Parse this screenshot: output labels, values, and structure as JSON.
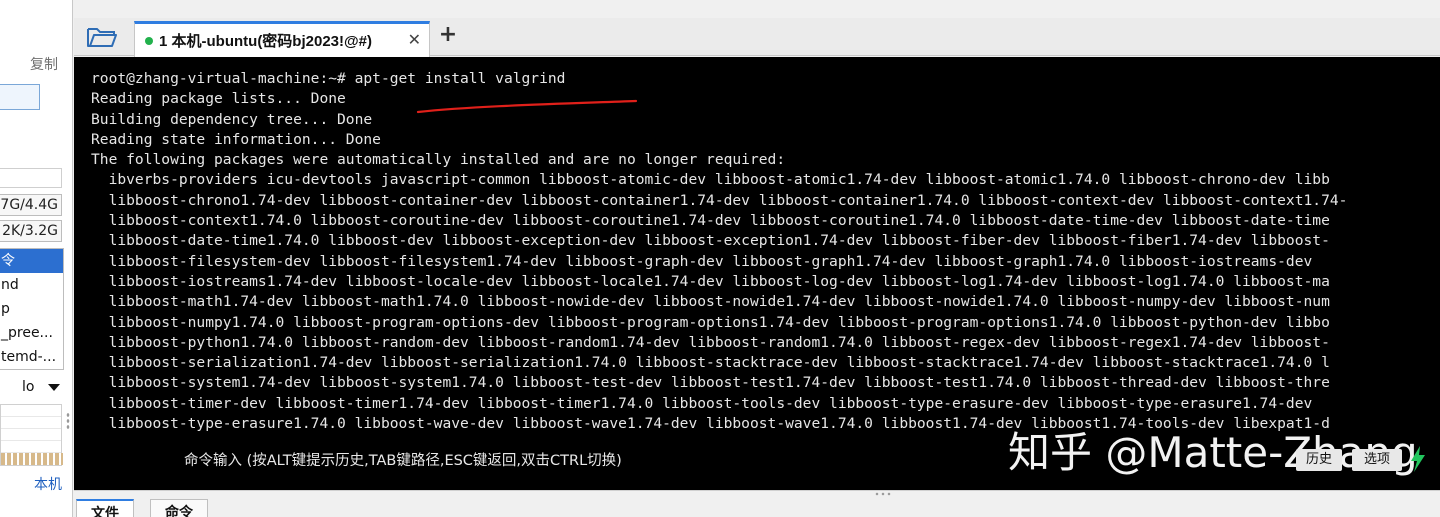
{
  "sidebar": {
    "copy_label": "复制",
    "stats": [
      "7G/4.4G",
      "2K/3.2G"
    ],
    "process_items": [
      "令",
      "nd",
      "p",
      "_pree...",
      "temd-..."
    ],
    "selected_index": 0,
    "dropdown_value": "lo",
    "local_label": "本机"
  },
  "tabbar": {
    "tab_title": "1 本机-ubuntu(密码bj2023!@#)",
    "tab_status_color": "#22b14c",
    "close_glyph": "✕",
    "add_glyph": "+"
  },
  "terminal": {
    "lines": [
      "root@zhang-virtual-machine:~# apt-get install valgrind",
      "Reading package lists... Done",
      "Building dependency tree... Done",
      "Reading state information... Done",
      "The following packages were automatically installed and are no longer required:",
      "  ibverbs-providers icu-devtools javascript-common libboost-atomic-dev libboost-atomic1.74-dev libboost-atomic1.74.0 libboost-chrono-dev libb",
      "  libboost-chrono1.74-dev libboost-container-dev libboost-container1.74-dev libboost-container1.74.0 libboost-context-dev libboost-context1.74-",
      "  libboost-context1.74.0 libboost-coroutine-dev libboost-coroutine1.74-dev libboost-coroutine1.74.0 libboost-date-time-dev libboost-date-time",
      "  libboost-date-time1.74.0 libboost-dev libboost-exception-dev libboost-exception1.74-dev libboost-fiber-dev libboost-fiber1.74-dev libboost-",
      "  libboost-filesystem-dev libboost-filesystem1.74-dev libboost-graph-dev libboost-graph1.74-dev libboost-graph1.74.0 libboost-iostreams-dev",
      "  libboost-iostreams1.74-dev libboost-locale-dev libboost-locale1.74-dev libboost-log-dev libboost-log1.74-dev libboost-log1.74.0 libboost-ma",
      "  libboost-math1.74-dev libboost-math1.74.0 libboost-nowide-dev libboost-nowide1.74-dev libboost-nowide1.74.0 libboost-numpy-dev libboost-num",
      "  libboost-numpy1.74.0 libboost-program-options-dev libboost-program-options1.74-dev libboost-program-options1.74.0 libboost-python-dev libbo",
      "  libboost-python1.74.0 libboost-random-dev libboost-random1.74-dev libboost-random1.74.0 libboost-regex-dev libboost-regex1.74-dev libboost-",
      "  libboost-serialization1.74-dev libboost-serialization1.74.0 libboost-stacktrace-dev libboost-stacktrace1.74-dev libboost-stacktrace1.74.0 l",
      "  libboost-system1.74-dev libboost-system1.74.0 libboost-test-dev libboost-test1.74-dev libboost-test1.74.0 libboost-thread-dev libboost-thre",
      "  libboost-timer-dev libboost-timer1.74-dev libboost-timer1.74.0 libboost-tools-dev libboost-type-erasure-dev libboost-type-erasure1.74-dev",
      "  libboost-type-erasure1.74.0 libboost-wave-dev libboost-wave1.74-dev libboost-wave1.74.0 libboost1.74-dev libboost1.74-tools-dev libexpat1-d"
    ],
    "command_hint": "命令输入 (按ALT键提示历史,TAB键路径,ESC键返回,双击CTRL切换)",
    "watermark": "知乎 @Matte-Zhang",
    "history_button": "历史",
    "options_button": "选项",
    "annotation_color": "#e0201a"
  },
  "bottom": {
    "tabs": [
      "文件",
      "命令"
    ],
    "active_index": 0
  },
  "colors": {
    "accent": "#2f7de1",
    "terminal_bg": "#000000",
    "terminal_fg": "#e6e6e6"
  }
}
